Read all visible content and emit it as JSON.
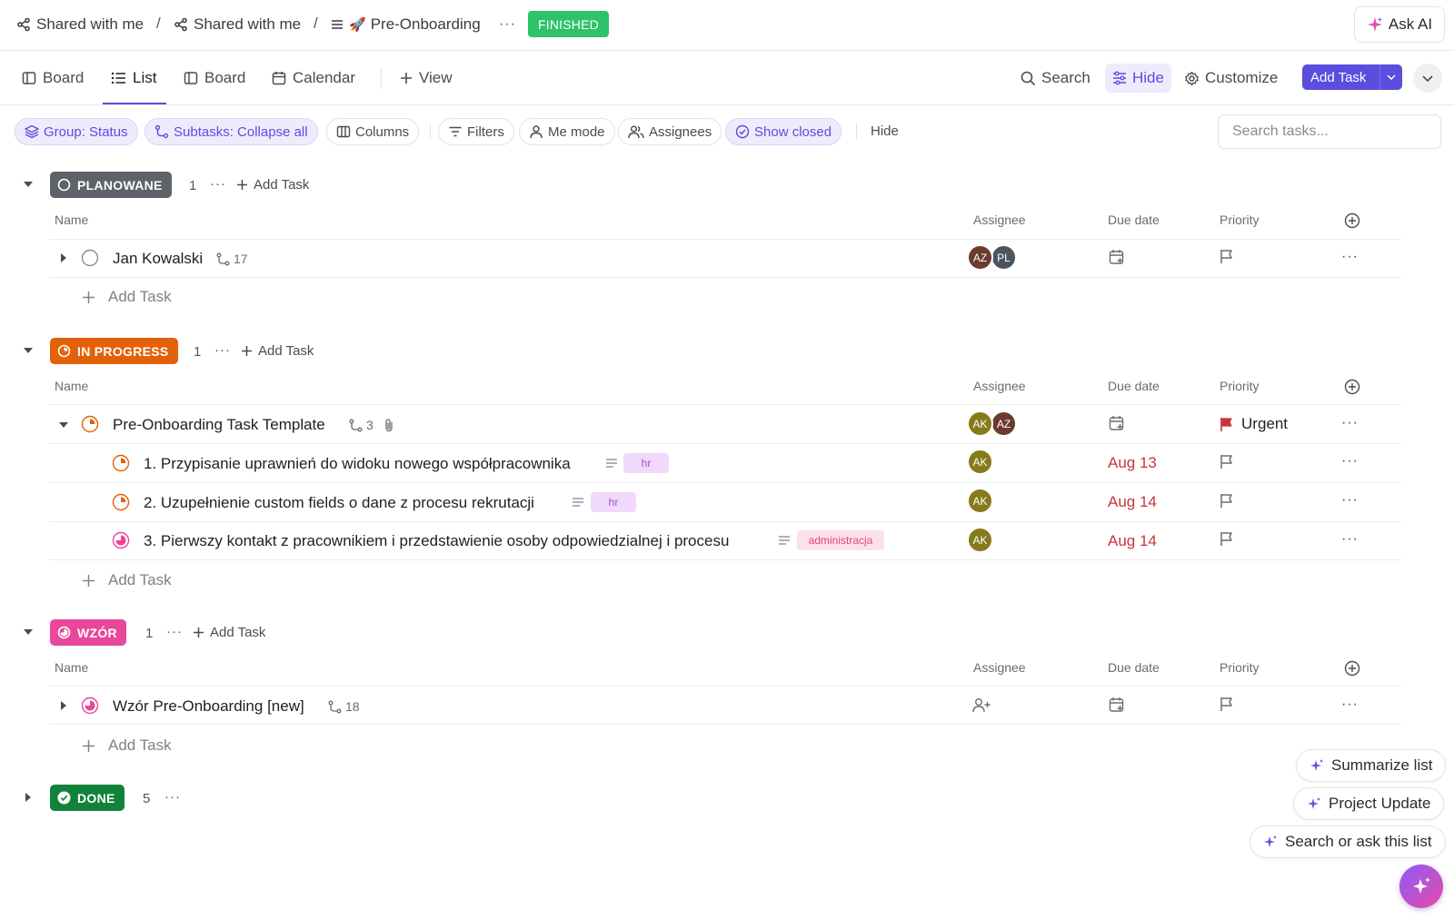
{
  "breadcrumbs": {
    "item1": "Shared with me",
    "item2": "Shared with me",
    "sep": "/",
    "list_emoji": "🚀",
    "list_name": "Pre-Onboarding",
    "more": "···",
    "status": "FINISHED"
  },
  "ask_ai": "Ask AI",
  "views": {
    "board1": "Board",
    "list": "List",
    "board2": "Board",
    "calendar": "Calendar",
    "add_view": "View"
  },
  "toolbar": {
    "search": "Search",
    "hide": "Hide",
    "customize": "Customize",
    "add_task": "Add Task"
  },
  "filters": {
    "group": "Group: Status",
    "subtasks": "Subtasks: Collapse all",
    "columns": "Columns",
    "filters": "Filters",
    "me_mode": "Me mode",
    "assignees": "Assignees",
    "show_closed": "Show closed",
    "hide": "Hide",
    "search_placeholder": "Search tasks..."
  },
  "columns": {
    "name": "Name",
    "assignee": "Assignee",
    "due": "Due date",
    "priority": "Priority"
  },
  "add_task": "Add Task",
  "groups": {
    "planowane": {
      "label": "PLANOWANE",
      "count": "1",
      "color": "#5f6269",
      "task": {
        "name": "Jan Kowalski",
        "subtasks": "17",
        "assignees": [
          "AZ",
          "PL"
        ]
      }
    },
    "in_progress": {
      "label": "IN PROGRESS",
      "count": "1",
      "color": "#e36209",
      "task": {
        "name": "Pre-Onboarding Task Template",
        "subtasks": "3",
        "assignees": [
          "AK",
          "AZ"
        ],
        "priority": "Urgent"
      },
      "subtasks": [
        {
          "name": "1. Przypisanie uprawnień do widoku nowego współpracownika",
          "tag": "hr",
          "assignee": "AK",
          "due": "Aug 13"
        },
        {
          "name": "2. Uzupełnienie custom fields o dane z procesu rekrutacji",
          "tag": "hr",
          "assignee": "AK",
          "due": "Aug 14"
        },
        {
          "name": "3. Pierwszy kontakt z pracownikiem i przedstawienie osoby odpowiedzialnej i procesu",
          "tag": "administracja",
          "assignee": "AK",
          "due": "Aug 14"
        }
      ]
    },
    "wzor": {
      "label": "WZÓR",
      "count": "1",
      "color": "#e8479a",
      "task": {
        "name": "Wzór Pre-Onboarding [new]",
        "subtasks": "18"
      }
    },
    "done": {
      "label": "DONE",
      "count": "5",
      "color": "#12823b"
    }
  },
  "avatar_colors": {
    "AZ": "#6b3b2e",
    "PL": "#4a5560",
    "AK": "#857a1c"
  },
  "ai_actions": {
    "summarize": "Summarize list",
    "update": "Project Update",
    "ask": "Search or ask this list"
  }
}
